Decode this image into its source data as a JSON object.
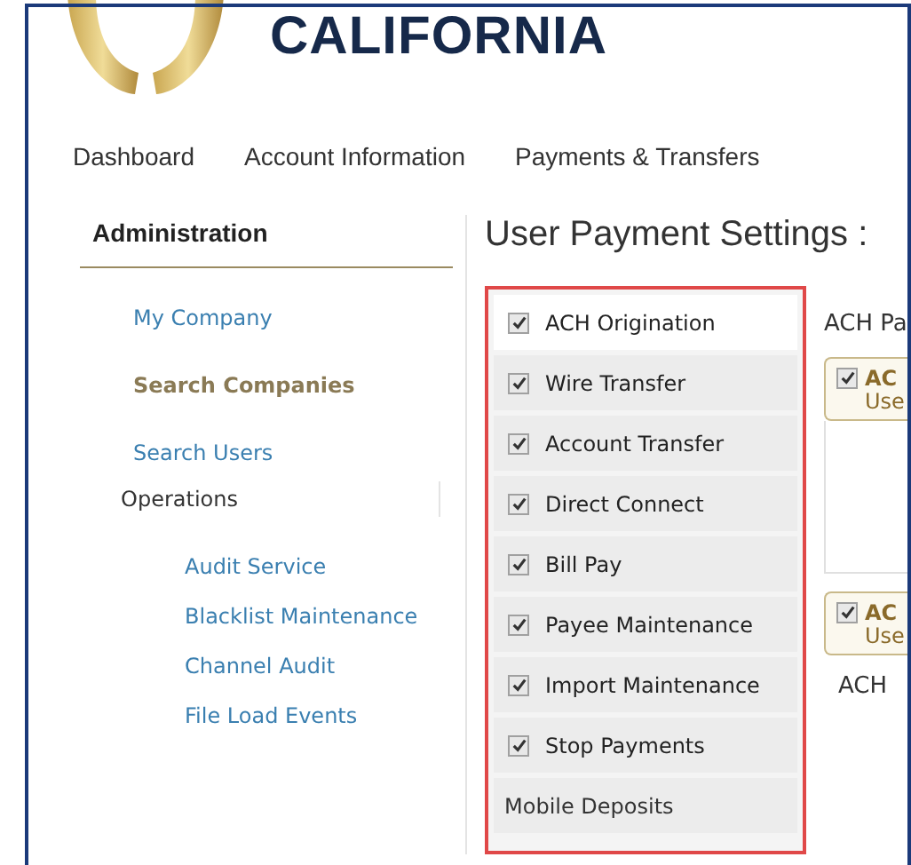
{
  "header": {
    "brand": "CALIFORNIA"
  },
  "nav": [
    {
      "label": "Dashboard"
    },
    {
      "label": "Account Information"
    },
    {
      "label": "Payments & Transfers"
    }
  ],
  "sidebar": {
    "title": "Administration",
    "items": [
      {
        "label": "My Company",
        "selected": false
      },
      {
        "label": "Search Companies",
        "selected": true
      },
      {
        "label": "Search Users",
        "selected": false
      },
      {
        "label": "Operations",
        "selected": false,
        "children": [
          {
            "label": "Audit Service",
            "selected": false
          },
          {
            "label": "Blacklist Maintenance",
            "selected": false
          },
          {
            "label": "Channel Audit",
            "selected": false
          },
          {
            "label": "File Load Events",
            "selected": false
          }
        ]
      }
    ]
  },
  "page_title": "User Payment Settings :",
  "payment_types": [
    {
      "label": "ACH Origination",
      "kind": "checkbox",
      "checked": true,
      "selected": true
    },
    {
      "label": "Wire Transfer",
      "kind": "checkbox",
      "checked": true,
      "selected": false
    },
    {
      "label": "Account Transfer",
      "kind": "checkbox",
      "checked": true,
      "selected": false
    },
    {
      "label": "Direct Connect",
      "kind": "checkbox",
      "checked": true,
      "selected": false
    },
    {
      "label": "Bill Pay",
      "kind": "checkbox",
      "checked": true,
      "selected": false
    },
    {
      "label": "Payee Maintenance",
      "kind": "checkbox",
      "checked": true,
      "selected": false
    },
    {
      "label": "Import Maintenance",
      "kind": "checkbox",
      "checked": true,
      "selected": false
    },
    {
      "label": "Stop Payments",
      "kind": "checkbox",
      "checked": true,
      "selected": false
    },
    {
      "label": "Mobile Deposits",
      "kind": "heading"
    }
  ],
  "detail": {
    "heading": "ACH Pa",
    "cards": [
      {
        "title": "AC",
        "subtitle": "Use",
        "checked": true
      },
      {
        "title": "AC",
        "subtitle": "Use",
        "checked": true
      }
    ],
    "footer_text": "ACH"
  }
}
